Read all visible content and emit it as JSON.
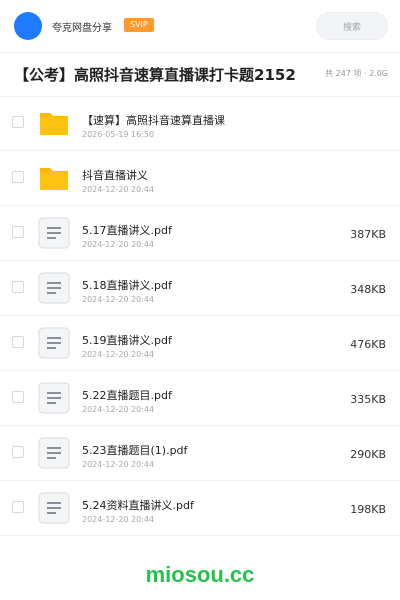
{
  "header": {
    "user_name": "夸克网盘分享",
    "vip_badge": "SVIP",
    "search_placeholder": "搜索"
  },
  "folder": {
    "title": "【公考】高照抖音速算直播课打卡题2152",
    "meta": "共 247 项 · 2.0G"
  },
  "files": [
    {
      "name": "【速算】高照抖音速算直播课",
      "time": "2026-05-19 16:50",
      "size": "",
      "type": "folder"
    },
    {
      "name": "抖音直播讲义",
      "time": "2024-12-20 20:44",
      "size": "",
      "type": "folder"
    },
    {
      "name": "5.17直播讲义.pdf",
      "time": "2024-12-20 20:44",
      "size": "387KB",
      "type": "document"
    },
    {
      "name": "5.18直播讲义.pdf",
      "time": "2024-12-20 20:44",
      "size": "348KB",
      "type": "document"
    },
    {
      "name": "5.19直播讲义.pdf",
      "time": "2024-12-20 20:44",
      "size": "476KB",
      "type": "document"
    },
    {
      "name": "5.22直播题目.pdf",
      "time": "2024-12-20 20:44",
      "size": "335KB",
      "type": "document"
    },
    {
      "name": "5.23直播题目(1).pdf",
      "time": "2024-12-20 20:44",
      "size": "290KB",
      "type": "document"
    },
    {
      "name": "5.24资料直播讲义.pdf",
      "time": "2024-12-20 20:44",
      "size": "198KB",
      "type": "document"
    }
  ],
  "watermark": "miosou.cc",
  "colors": {
    "accent_blue": "#1e7bff",
    "vip_orange": "#ff9a2e",
    "folder_yellow": "#ffc20e",
    "watermark_green": "#27c24c"
  }
}
